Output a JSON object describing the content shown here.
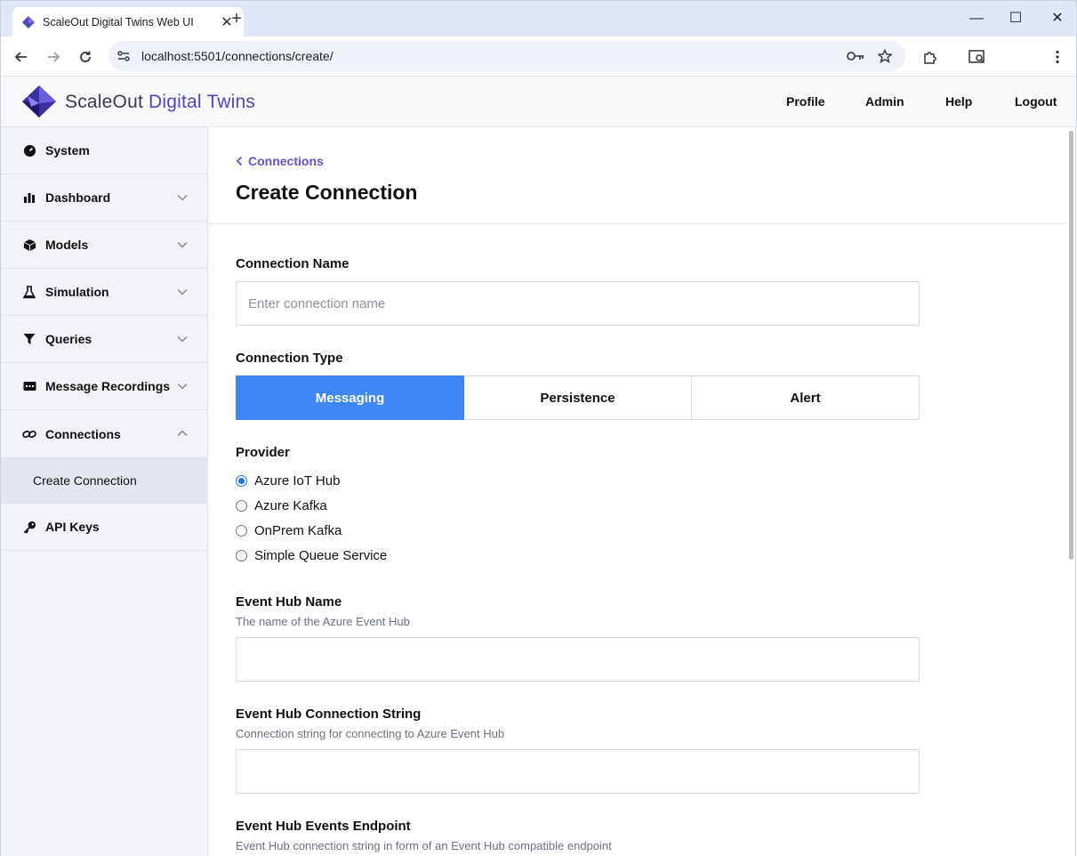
{
  "browser": {
    "tab_title": "ScaleOut Digital Twins Web UI",
    "url": "localhost:5501/connections/create/"
  },
  "header": {
    "brand_prefix": "ScaleOut",
    "brand_accent": "Digital Twins",
    "nav": [
      "Profile",
      "Admin",
      "Help",
      "Logout"
    ]
  },
  "sidebar": {
    "items": [
      {
        "label": "System",
        "icon": "gauge-icon"
      },
      {
        "label": "Dashboard",
        "icon": "bar-chart-icon"
      },
      {
        "label": "Models",
        "icon": "cube-icon"
      },
      {
        "label": "Simulation",
        "icon": "flask-icon"
      },
      {
        "label": "Queries",
        "icon": "filter-icon"
      },
      {
        "label": "Message Recordings",
        "icon": "message-icon"
      },
      {
        "label": "Connections",
        "icon": "link-icon"
      },
      {
        "label": "API Keys",
        "icon": "key-icon"
      }
    ],
    "sub_item": "Create Connection"
  },
  "main": {
    "breadcrumb": "Connections",
    "title": "Create Connection",
    "connection_name": {
      "label": "Connection Name",
      "placeholder": "Enter connection name",
      "value": ""
    },
    "connection_type": {
      "label": "Connection Type",
      "options": [
        "Messaging",
        "Persistence",
        "Alert"
      ],
      "selected": "Messaging"
    },
    "provider": {
      "label": "Provider",
      "options": [
        "Azure IoT Hub",
        "Azure Kafka",
        "OnPrem Kafka",
        "Simple Queue Service"
      ],
      "selected": "Azure IoT Hub"
    },
    "event_hub_name": {
      "label": "Event Hub Name",
      "help": "The name of the Azure Event Hub",
      "value": ""
    },
    "event_hub_connection_string": {
      "label": "Event Hub Connection String",
      "help": "Connection string for connecting to Azure Event Hub",
      "value": ""
    },
    "event_hub_events_endpoint": {
      "label": "Event Hub Events Endpoint",
      "help": "Event Hub connection string in form of an Event Hub compatible endpoint"
    }
  },
  "colors": {
    "accent": "#3f87f5",
    "brand": "#4e49b8",
    "link": "#5b55c9"
  }
}
